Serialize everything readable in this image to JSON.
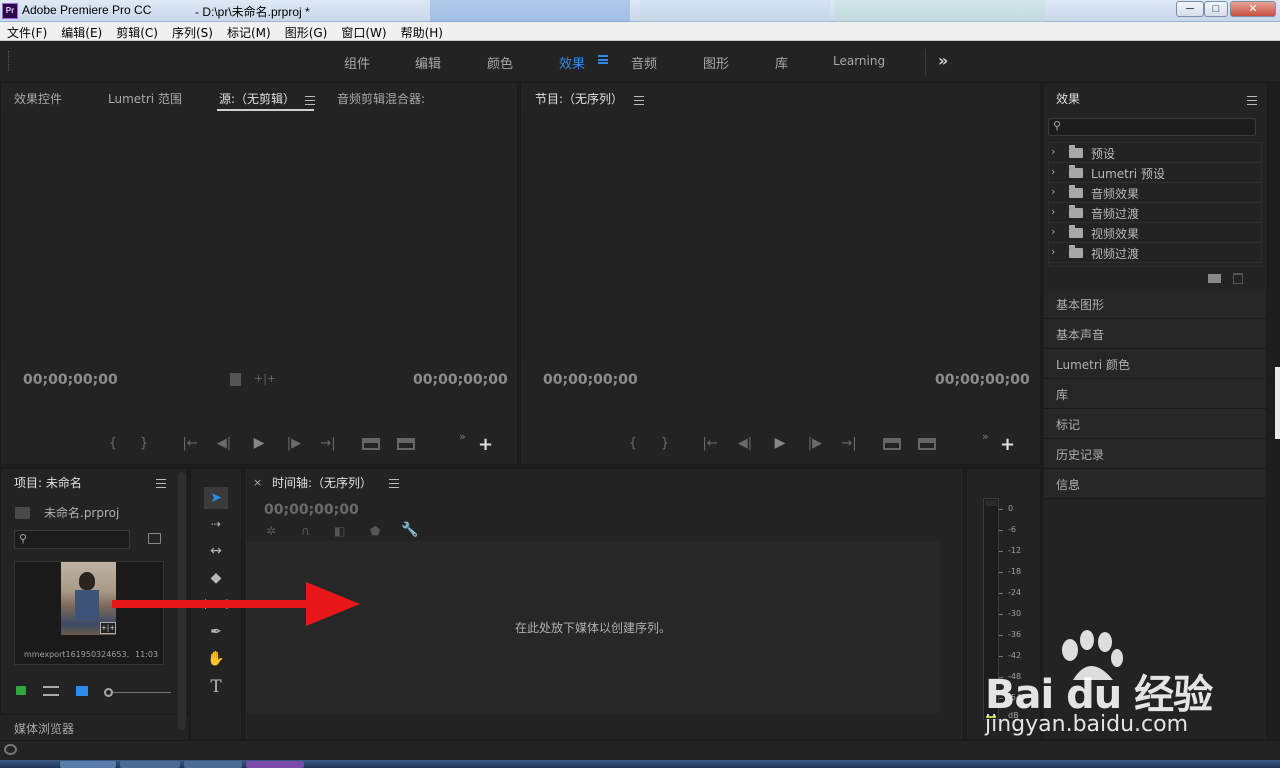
{
  "window": {
    "app_icon_text": "Pr",
    "app_title": "Adobe Premiere Pro CC",
    "doc_title": "- D:\\pr\\未命名.prproj *",
    "minimize": "─",
    "maximize": "□",
    "close": "✕"
  },
  "menu": [
    "文件(F)",
    "编辑(E)",
    "剪辑(C)",
    "序列(S)",
    "标记(M)",
    "图形(G)",
    "窗口(W)",
    "帮助(H)"
  ],
  "workspaces": {
    "tabs": [
      "组件",
      "编辑",
      "颜色",
      "效果",
      "音频",
      "图形",
      "库",
      "Learning"
    ],
    "active": "效果",
    "more": "»"
  },
  "source_panel": {
    "tabs": [
      "效果控件",
      "Lumetri 范围",
      "源:（无剪辑）",
      "音频剪辑混合器:"
    ],
    "active_tab": "源:（无剪辑）",
    "timecode_left": "00;00;00;00",
    "timecode_right": "00;00;00;00"
  },
  "program_panel": {
    "title": "节目:（无序列）",
    "timecode_left": "00;00;00;00",
    "timecode_right": "00;00;00;00"
  },
  "transport_controls": [
    "{",
    "}",
    "|←",
    "◀|",
    "▶",
    "|▶",
    "→|"
  ],
  "effects_panel": {
    "title": "效果",
    "search_placeholder": "",
    "items": [
      "预设",
      "Lumetri 预设",
      "音频效果",
      "音频过渡",
      "视频效果",
      "视频过渡"
    ]
  },
  "side_panels": [
    "基本图形",
    "基本声音",
    "Lumetri 颜色",
    "库",
    "标记",
    "历史记录",
    "信息"
  ],
  "project_panel": {
    "title": "项目: 未命名",
    "file_name": "未命名.prproj",
    "clip_name": "mmexport1619503246​53...",
    "clip_duration": "11:03",
    "media_browser": "媒体浏览器"
  },
  "timeline": {
    "close": "×",
    "title": "时间轴:（无序列）",
    "timecode": "00;00;00;00",
    "empty_message": "在此处放下媒体以创建序列。"
  },
  "tools": [
    "select-tool",
    "track-select-tool",
    "ripple-edit-tool",
    "razor-tool",
    "slip-tool",
    "pen-tool",
    "hand-tool",
    "type-tool"
  ],
  "audio_meter": {
    "db_labels": [
      "0",
      "-6",
      "-12",
      "-18",
      "-24",
      "-30",
      "-36",
      "-42",
      "-48",
      "-54",
      "dB"
    ]
  },
  "watermark": {
    "brand": "Bai du 经验",
    "url": "jingyan.baidu.com"
  },
  "colors": {
    "accent": "#2d8ceb",
    "arrow": "#e81818",
    "panel_bg": "#232323"
  }
}
